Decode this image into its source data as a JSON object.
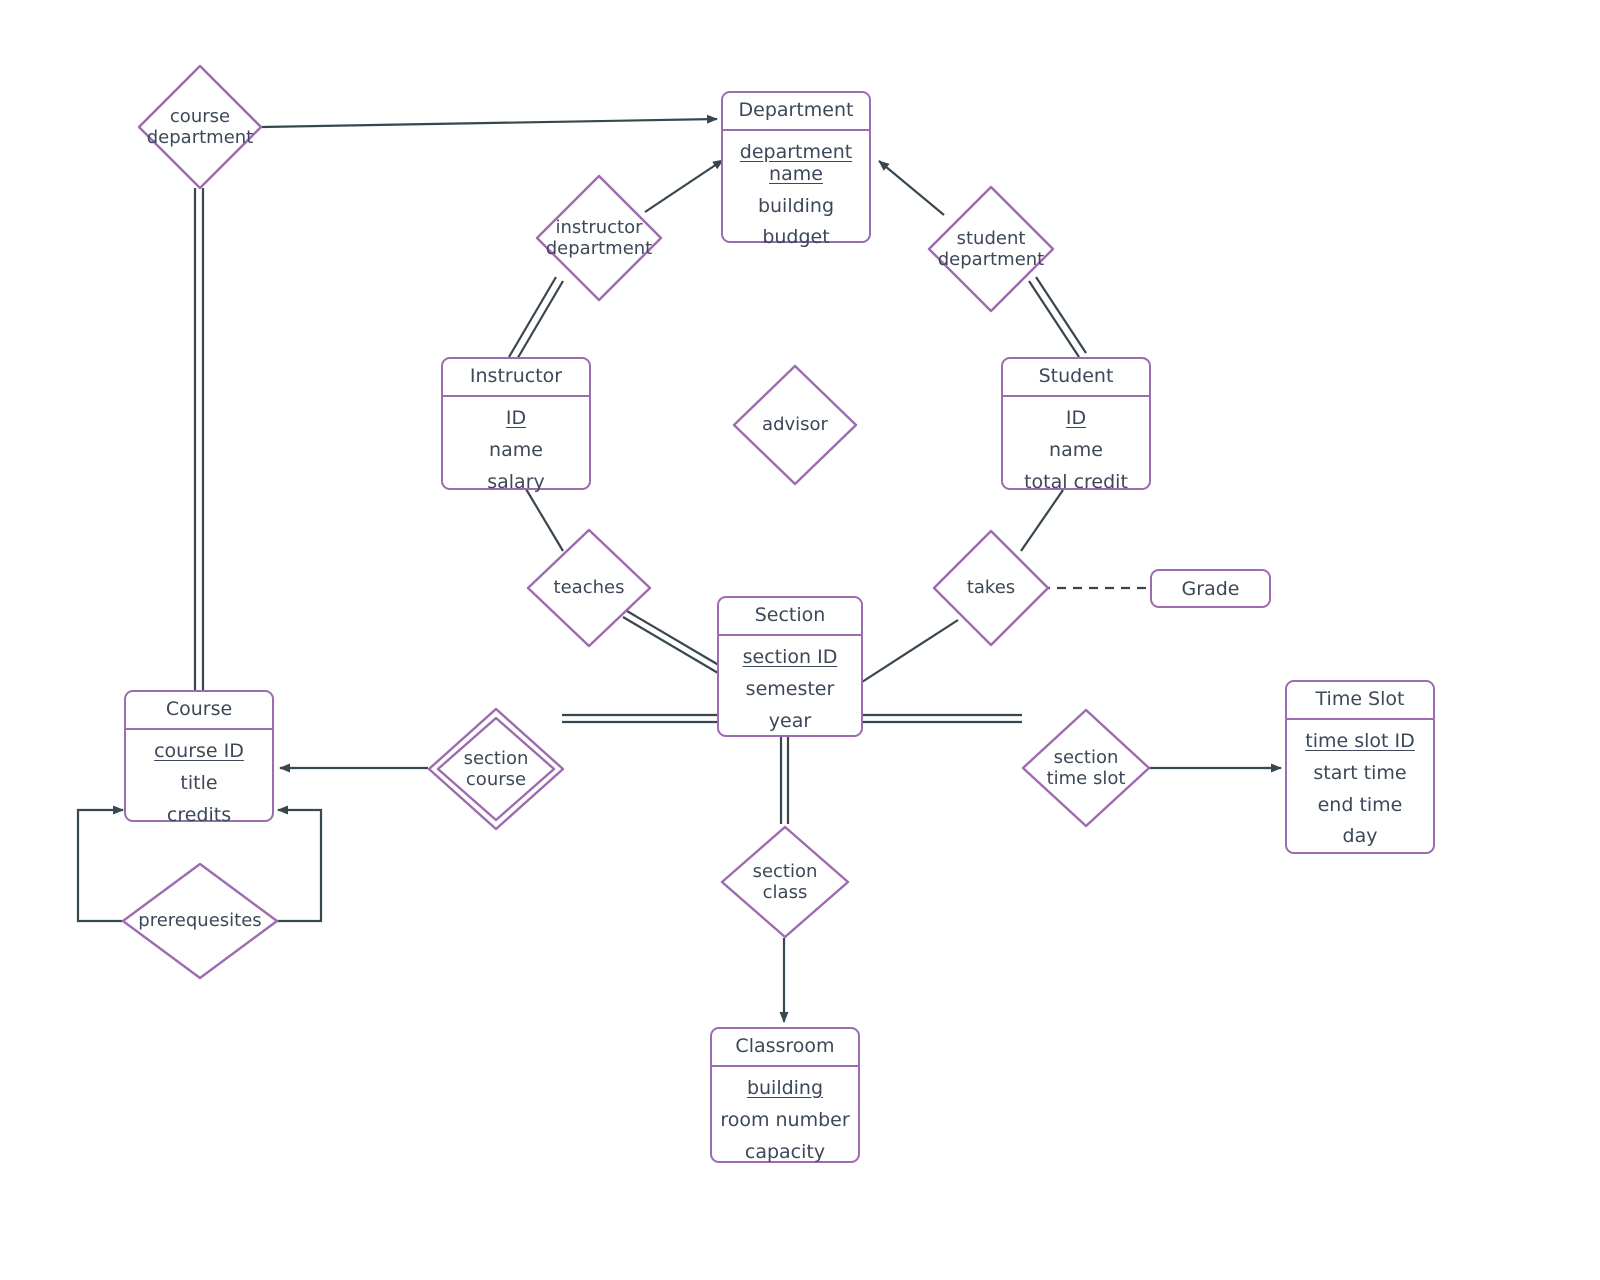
{
  "diagram": {
    "title": "University ER Diagram",
    "colors": {
      "entity_border": "#9d6bb0",
      "line": "#37474f",
      "text": "#3c4858",
      "background": "#ffffff"
    }
  },
  "entities": [
    {
      "id": "department",
      "name": "Department",
      "attributes": [
        {
          "label": "department\nname",
          "key": true
        },
        {
          "label": "building",
          "key": false
        },
        {
          "label": "budget",
          "key": false
        }
      ]
    },
    {
      "id": "instructor",
      "name": "Instructor",
      "attributes": [
        {
          "label": "ID",
          "key": true
        },
        {
          "label": "name",
          "key": false
        },
        {
          "label": "salary",
          "key": false
        }
      ]
    },
    {
      "id": "student",
      "name": "Student",
      "attributes": [
        {
          "label": "ID",
          "key": true
        },
        {
          "label": "name",
          "key": false
        },
        {
          "label": "total credit",
          "key": false
        }
      ]
    },
    {
      "id": "section",
      "name": "Section",
      "attributes": [
        {
          "label": "section ID",
          "key": true
        },
        {
          "label": "semester",
          "key": false
        },
        {
          "label": "year",
          "key": false
        }
      ]
    },
    {
      "id": "course",
      "name": "Course",
      "attributes": [
        {
          "label": "course ID",
          "key": true
        },
        {
          "label": "title",
          "key": false
        },
        {
          "label": "credits",
          "key": false
        }
      ]
    },
    {
      "id": "timeslot",
      "name": "Time Slot",
      "attributes": [
        {
          "label": "time slot ID",
          "key": true
        },
        {
          "label": "start time",
          "key": false
        },
        {
          "label": "end time",
          "key": false
        },
        {
          "label": "day",
          "key": false
        }
      ]
    },
    {
      "id": "classroom",
      "name": "Classroom",
      "attributes": [
        {
          "label": "building",
          "key": true
        },
        {
          "label": "room number",
          "key": false
        },
        {
          "label": "capacity",
          "key": false
        }
      ]
    }
  ],
  "attribute_boxes": [
    {
      "id": "grade",
      "label": "Grade"
    }
  ],
  "relationships": [
    {
      "id": "course-department",
      "label": "course\ndepartment",
      "identifying": false
    },
    {
      "id": "instructor-department",
      "label": "instructor\ndepartment",
      "identifying": false
    },
    {
      "id": "student-department",
      "label": "student\ndepartment",
      "identifying": false
    },
    {
      "id": "advisor",
      "label": "advisor",
      "identifying": false
    },
    {
      "id": "teaches",
      "label": "teaches",
      "identifying": false
    },
    {
      "id": "takes",
      "label": "takes",
      "identifying": false
    },
    {
      "id": "section-course",
      "label": "section\ncourse",
      "identifying": true
    },
    {
      "id": "section-time-slot",
      "label": "section\ntime slot",
      "identifying": false
    },
    {
      "id": "section-class",
      "label": "section\nclass",
      "identifying": false
    },
    {
      "id": "prerequesites",
      "label": "prerequesites",
      "identifying": false
    }
  ]
}
